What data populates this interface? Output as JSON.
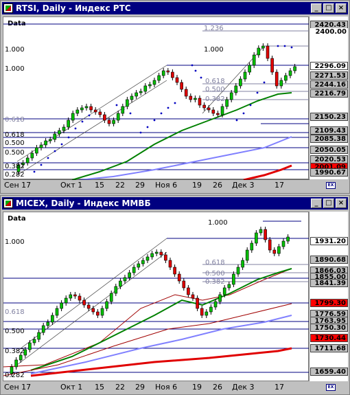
{
  "top_window": {
    "title": "RTSI, Daily - Индекс РТС",
    "data_label": "Data",
    "scale_top": "2420.43",
    "scale_2400": "2400.00",
    "current": "2296.09",
    "tags": [
      "2271.53",
      "2244.16",
      "2216.79",
      "2150.23",
      "2109.43",
      "2085.38",
      "2050.05",
      "2020.53",
      "2001.09",
      "1990.67"
    ],
    "fib_labels": [
      "1.236",
      "1.000",
      "0.618",
      "0.500",
      "0.382",
      "0.618",
      "0.500",
      "0.382",
      "0.618",
      "0.500",
      "1.000",
      "0.382",
      "0.282"
    ],
    "x_labels": [
      "Сен 17",
      "Окт 1",
      "15",
      "22",
      "29",
      "Ноя 6",
      "19",
      "26",
      "Дек 3",
      "17"
    ]
  },
  "bottom_window": {
    "title": "MICEX, Daily - Индекс ММВБ",
    "data_label": "Data",
    "current": "1931.20",
    "tags": [
      "1890.68",
      "1866.03",
      "1855.00",
      "1841.39",
      "1799.30",
      "1776.59",
      "1763.95",
      "1750.30",
      "1730.44",
      "1711.68",
      "1659.40"
    ],
    "fib_labels": [
      "1.000",
      "1.000",
      "0.618",
      "0.500",
      "0.382",
      "0.618",
      "0.500",
      "0.382",
      "0.382",
      "0.282",
      "0.382"
    ],
    "x_labels": [
      "Сен 17",
      "Окт 1",
      "15",
      "22",
      "29",
      "Ноя 6",
      "19",
      "26",
      "Дек 3",
      "17"
    ]
  },
  "buttons": {
    "minimize": "_",
    "maximize": "□",
    "close": "×",
    "chart_toggle": "EX"
  }
}
